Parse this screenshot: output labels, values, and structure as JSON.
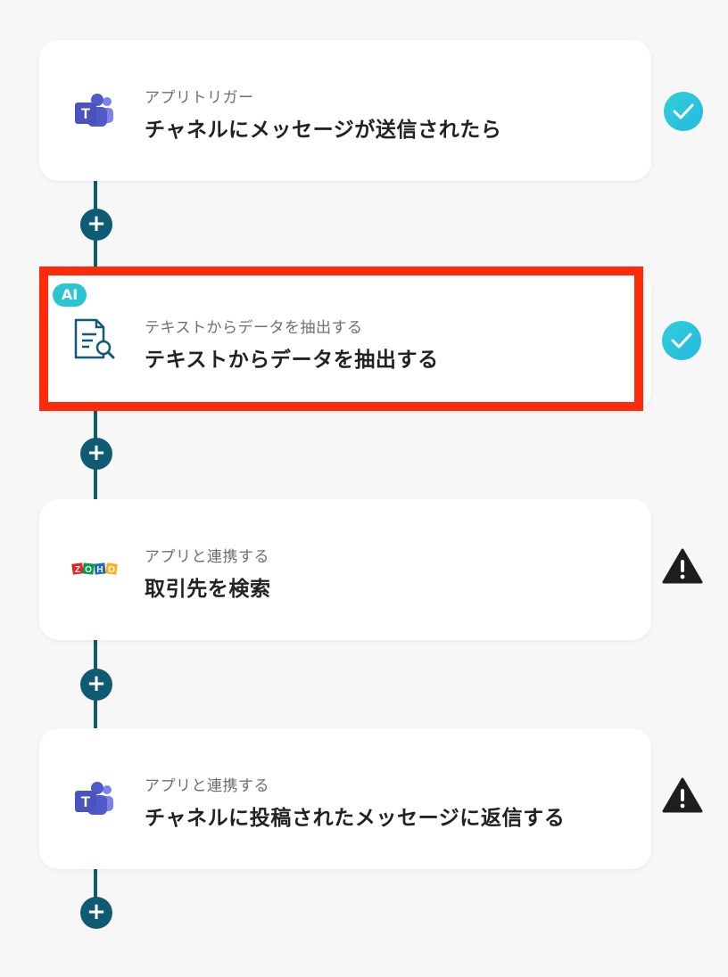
{
  "steps": [
    {
      "subtitle": "アプリトリガー",
      "title": "チャネルにメッセージが送信されたら",
      "app_icon": "teams-icon",
      "status": "check-circle-icon"
    },
    {
      "badge": "AI",
      "subtitle": "テキストからデータを抽出する",
      "title": "テキストからデータを抽出する",
      "app_icon": "document-search-icon",
      "status": "check-circle-icon"
    },
    {
      "subtitle": "アプリと連携する",
      "title": "取引先を検索",
      "app_icon": "zoho-logo-icon",
      "logo_text": "ZOHO",
      "status": "warning-triangle-icon"
    },
    {
      "subtitle": "アプリと連携する",
      "title": "チャネルに投稿されたメッセージに返信する",
      "app_icon": "teams-icon",
      "status": "warning-triangle-icon"
    }
  ],
  "add_button_label": "+",
  "colors": {
    "connector": "#0f5b74",
    "check": "#2cc4d0",
    "highlight": "#ff2a0a",
    "warning": "#1e1e1e"
  }
}
